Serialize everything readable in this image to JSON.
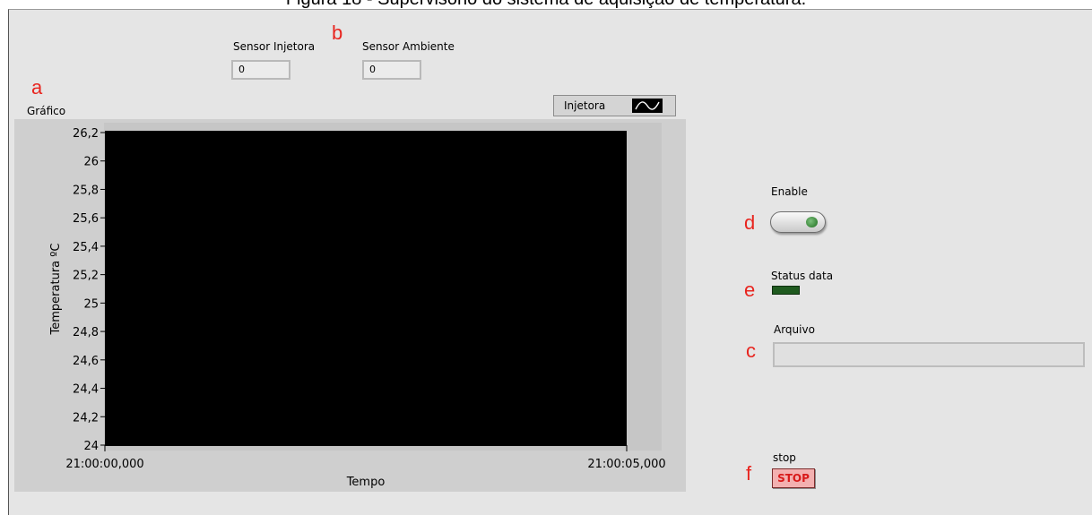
{
  "figure_caption": "Figura 18 - Supervisório do sistema de aquisição de temperatura.",
  "annotations": {
    "a": "a",
    "b": "b",
    "c": "c",
    "d": "d",
    "e": "e",
    "f": "f"
  },
  "indicators": [
    {
      "label": "Sensor Injetora",
      "value": "0"
    },
    {
      "label": "Sensor Ambiente",
      "value": "0"
    }
  ],
  "graph": {
    "title": "Gráfico",
    "legend_label": "Injetora",
    "legend_icon": "line-plot-icon",
    "ylabel": "Temperatura ºC",
    "xlabel": "Tempo",
    "plot_background": "#000000"
  },
  "chart_data": {
    "type": "line",
    "title": "Gráfico",
    "xlabel": "Tempo",
    "ylabel": "Temperatura ºC",
    "x_tick_labels": [
      "21:00:00,000",
      "21:00:05,000"
    ],
    "y_ticks": [
      24,
      24.2,
      24.4,
      24.6,
      24.8,
      25,
      25.2,
      25.4,
      25.6,
      25.8,
      26,
      26.2
    ],
    "y_tick_labels": [
      "24",
      "24,2",
      "24,4",
      "24,6",
      "24,8",
      "25",
      "25,2",
      "25,4",
      "25,6",
      "25,8",
      "26",
      "26,2"
    ],
    "ylim": [
      24,
      26.2
    ],
    "series": [
      {
        "name": "Injetora",
        "values": []
      }
    ],
    "grid": false,
    "legend_position": "top-right"
  },
  "controls": {
    "enable_label": "Enable",
    "status_label": "Status data",
    "file_label": "Arquivo",
    "file_value": "",
    "stop_label": "stop",
    "stop_button_text": "STOP",
    "status_led_color": "#1f5a1f"
  }
}
